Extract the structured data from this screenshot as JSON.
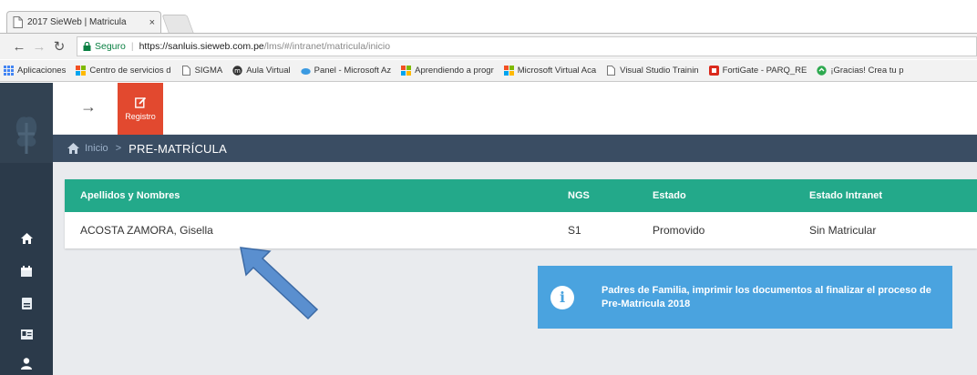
{
  "browser": {
    "tab_title": "2017 SieWeb | Matricula",
    "tab_close": "×",
    "secure_label": "Seguro",
    "url_host": "https://sanluis.sieweb.com.pe",
    "url_path": "/lms/#/intranet/matricula/inicio",
    "bookmarks": [
      {
        "label": "Aplicaciones",
        "icon": "apps-icon"
      },
      {
        "label": "Centro de servicios d",
        "icon": "microsoft-icon"
      },
      {
        "label": "SIGMA",
        "icon": "page-icon"
      },
      {
        "label": "Aula Virtual",
        "icon": "moodle-icon"
      },
      {
        "label": "Panel - Microsoft Az",
        "icon": "azure-icon"
      },
      {
        "label": "Aprendiendo a progr",
        "icon": "microsoft-icon"
      },
      {
        "label": "Microsoft Virtual Aca",
        "icon": "microsoft-icon"
      },
      {
        "label": "Visual Studio Trainin",
        "icon": "page-icon"
      },
      {
        "label": "FortiGate - PARQ_RE",
        "icon": "fortigate-icon"
      },
      {
        "label": "¡Gracias! Crea tu p",
        "icon": "green-icon"
      }
    ]
  },
  "app": {
    "registro_label": "Registro",
    "breadcrumb": {
      "home": "Inicio",
      "separator": ">",
      "current": "PRE-MATRÍCULA"
    },
    "table": {
      "headers": [
        "Apellidos y Nombres",
        "NGS",
        "Estado",
        "Estado Intranet"
      ],
      "rows": [
        [
          "ACOSTA ZAMORA, Gisella",
          "S1",
          "Promovido",
          "Sin Matricular"
        ]
      ]
    },
    "info_message": "Padres de Familia, imprimir los documentos al finalizar el proceso de Pre-Matricula 2018",
    "info_icon": "i"
  },
  "colors": {
    "table_header": "#23a98a",
    "info_box": "#4aa3df",
    "registro": "#e2492f",
    "sidebar": "#2b3a4a",
    "breadcrumb_bar": "#3a4d63"
  }
}
